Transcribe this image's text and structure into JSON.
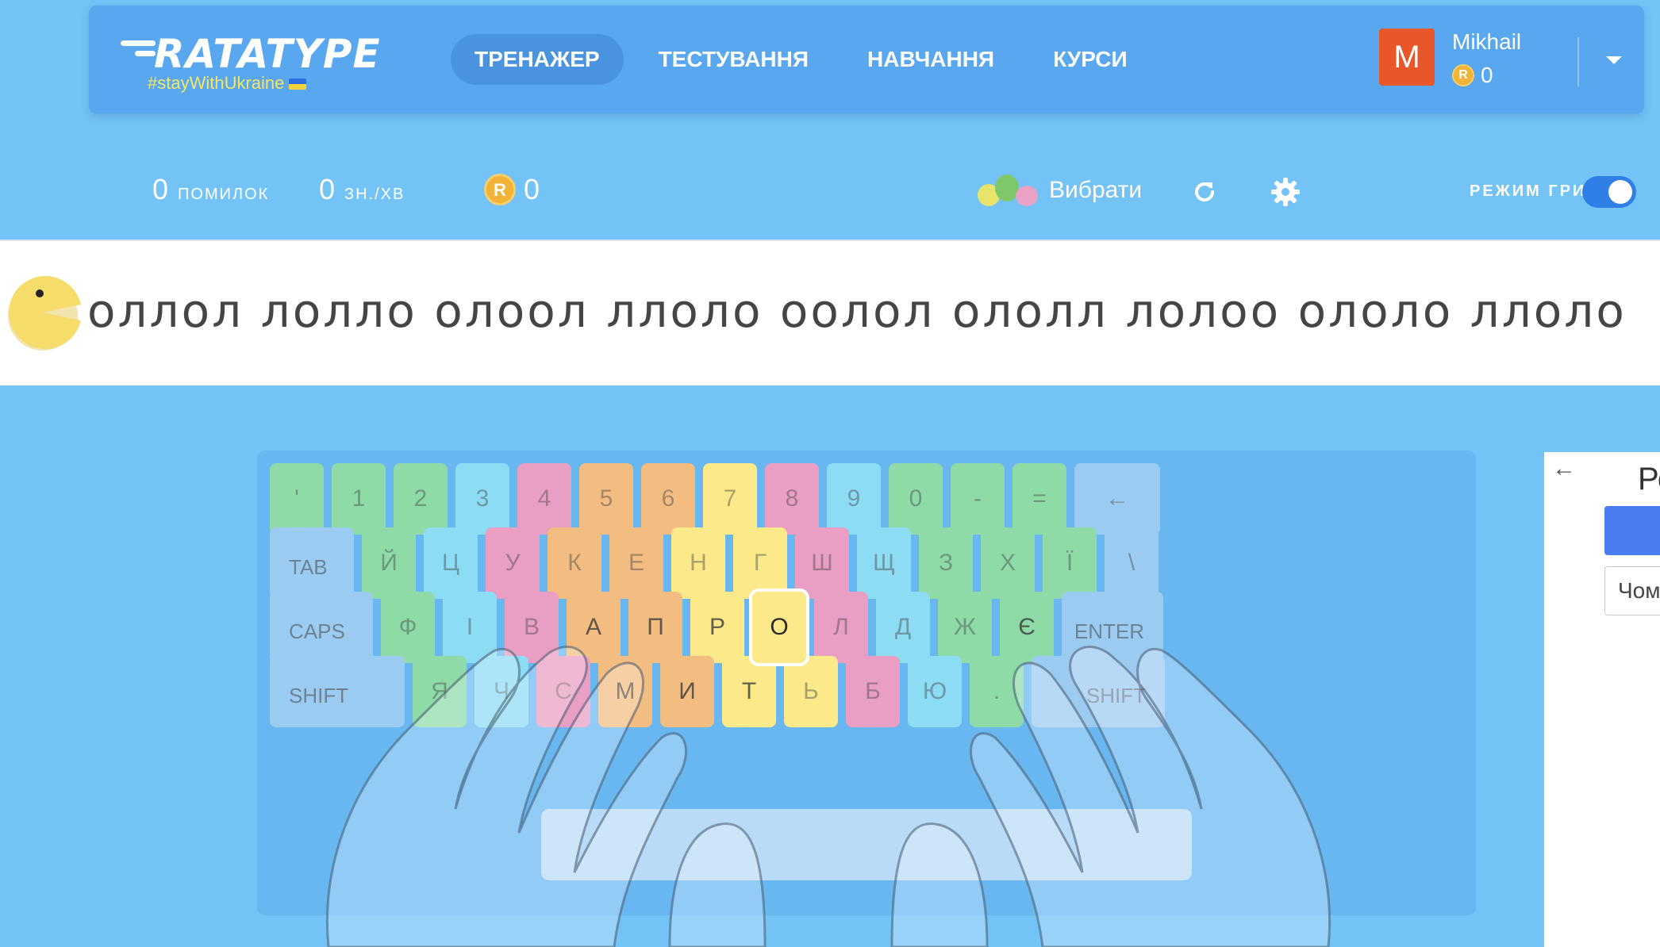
{
  "header": {
    "logo": "RATATYPE",
    "tagline": "#stayWithUkraine",
    "nav": [
      "ТРЕНАЖЕР",
      "ТЕСТУВАННЯ",
      "НАВЧАННЯ",
      "КУРСИ"
    ],
    "active_nav": "ТРЕНАЖЕР",
    "user": {
      "initial": "M",
      "name": "Mikhail",
      "coins": "0"
    }
  },
  "stats": {
    "errors_value": "0",
    "errors_label": "ПОМИЛОК",
    "speed_value": "0",
    "speed_label": "ЗН./ХВ",
    "coins_value": "0"
  },
  "toolbar": {
    "choose_label": "Вибрати",
    "game_mode_label": "РЕЖИМ ГРИ",
    "game_mode_on": true
  },
  "coin_symbol": "R",
  "exercise": {
    "text": "оллол лолло олоол ллоло оолол ололл лолоо ололо ллоло"
  },
  "keyboard": {
    "current_key": "О",
    "rows": [
      [
        [
          "'",
          "g"
        ],
        [
          "1",
          "g"
        ],
        [
          "2",
          "g"
        ],
        [
          "3",
          "b"
        ],
        [
          "4",
          "p"
        ],
        [
          "5",
          "o"
        ],
        [
          "6",
          "o"
        ],
        [
          "7",
          "y"
        ],
        [
          "8",
          "p"
        ],
        [
          "9",
          "b"
        ],
        [
          "0",
          "g"
        ],
        [
          "-",
          "g"
        ],
        [
          "=",
          "g"
        ],
        [
          "←",
          "gray"
        ]
      ],
      [
        [
          "TAB",
          "gray"
        ],
        [
          "Й",
          "g"
        ],
        [
          "Ц",
          "b"
        ],
        [
          "У",
          "p"
        ],
        [
          "К",
          "o"
        ],
        [
          "Е",
          "o"
        ],
        [
          "Н",
          "y"
        ],
        [
          "Г",
          "y"
        ],
        [
          "Ш",
          "p"
        ],
        [
          "Щ",
          "b"
        ],
        [
          "З",
          "g"
        ],
        [
          "Х",
          "g"
        ],
        [
          "Ї",
          "g"
        ],
        [
          "\\",
          "gray"
        ]
      ],
      [
        [
          "CAPS",
          "gray"
        ],
        [
          "Ф",
          "g"
        ],
        [
          "І",
          "b"
        ],
        [
          "В",
          "p"
        ],
        [
          "А",
          "o"
        ],
        [
          "П",
          "o"
        ],
        [
          "Р",
          "y"
        ],
        [
          "О",
          "y"
        ],
        [
          "Л",
          "p"
        ],
        [
          "Д",
          "b"
        ],
        [
          "Ж",
          "g"
        ],
        [
          "Є",
          "g"
        ],
        [
          "ENTER",
          "gray"
        ]
      ],
      [
        [
          "SHIFT",
          "gray"
        ],
        [
          "Я",
          "g"
        ],
        [
          "Ч",
          "b"
        ],
        [
          "С",
          "p"
        ],
        [
          "М",
          "o"
        ],
        [
          "И",
          "o"
        ],
        [
          "Т",
          "y"
        ],
        [
          "Ь",
          "y"
        ],
        [
          "Б",
          "p"
        ],
        [
          "Ю",
          "b"
        ],
        [
          ".",
          "g"
        ],
        [
          "SHIFT",
          "gray"
        ]
      ]
    ],
    "main_keys": [
      "А",
      "П",
      "Р",
      "О",
      "М",
      "И",
      "Т",
      "Є"
    ]
  },
  "side_panel": {
    "back_icon": "arrow-left-icon",
    "title": "Ре",
    "input_text": "Чом"
  }
}
